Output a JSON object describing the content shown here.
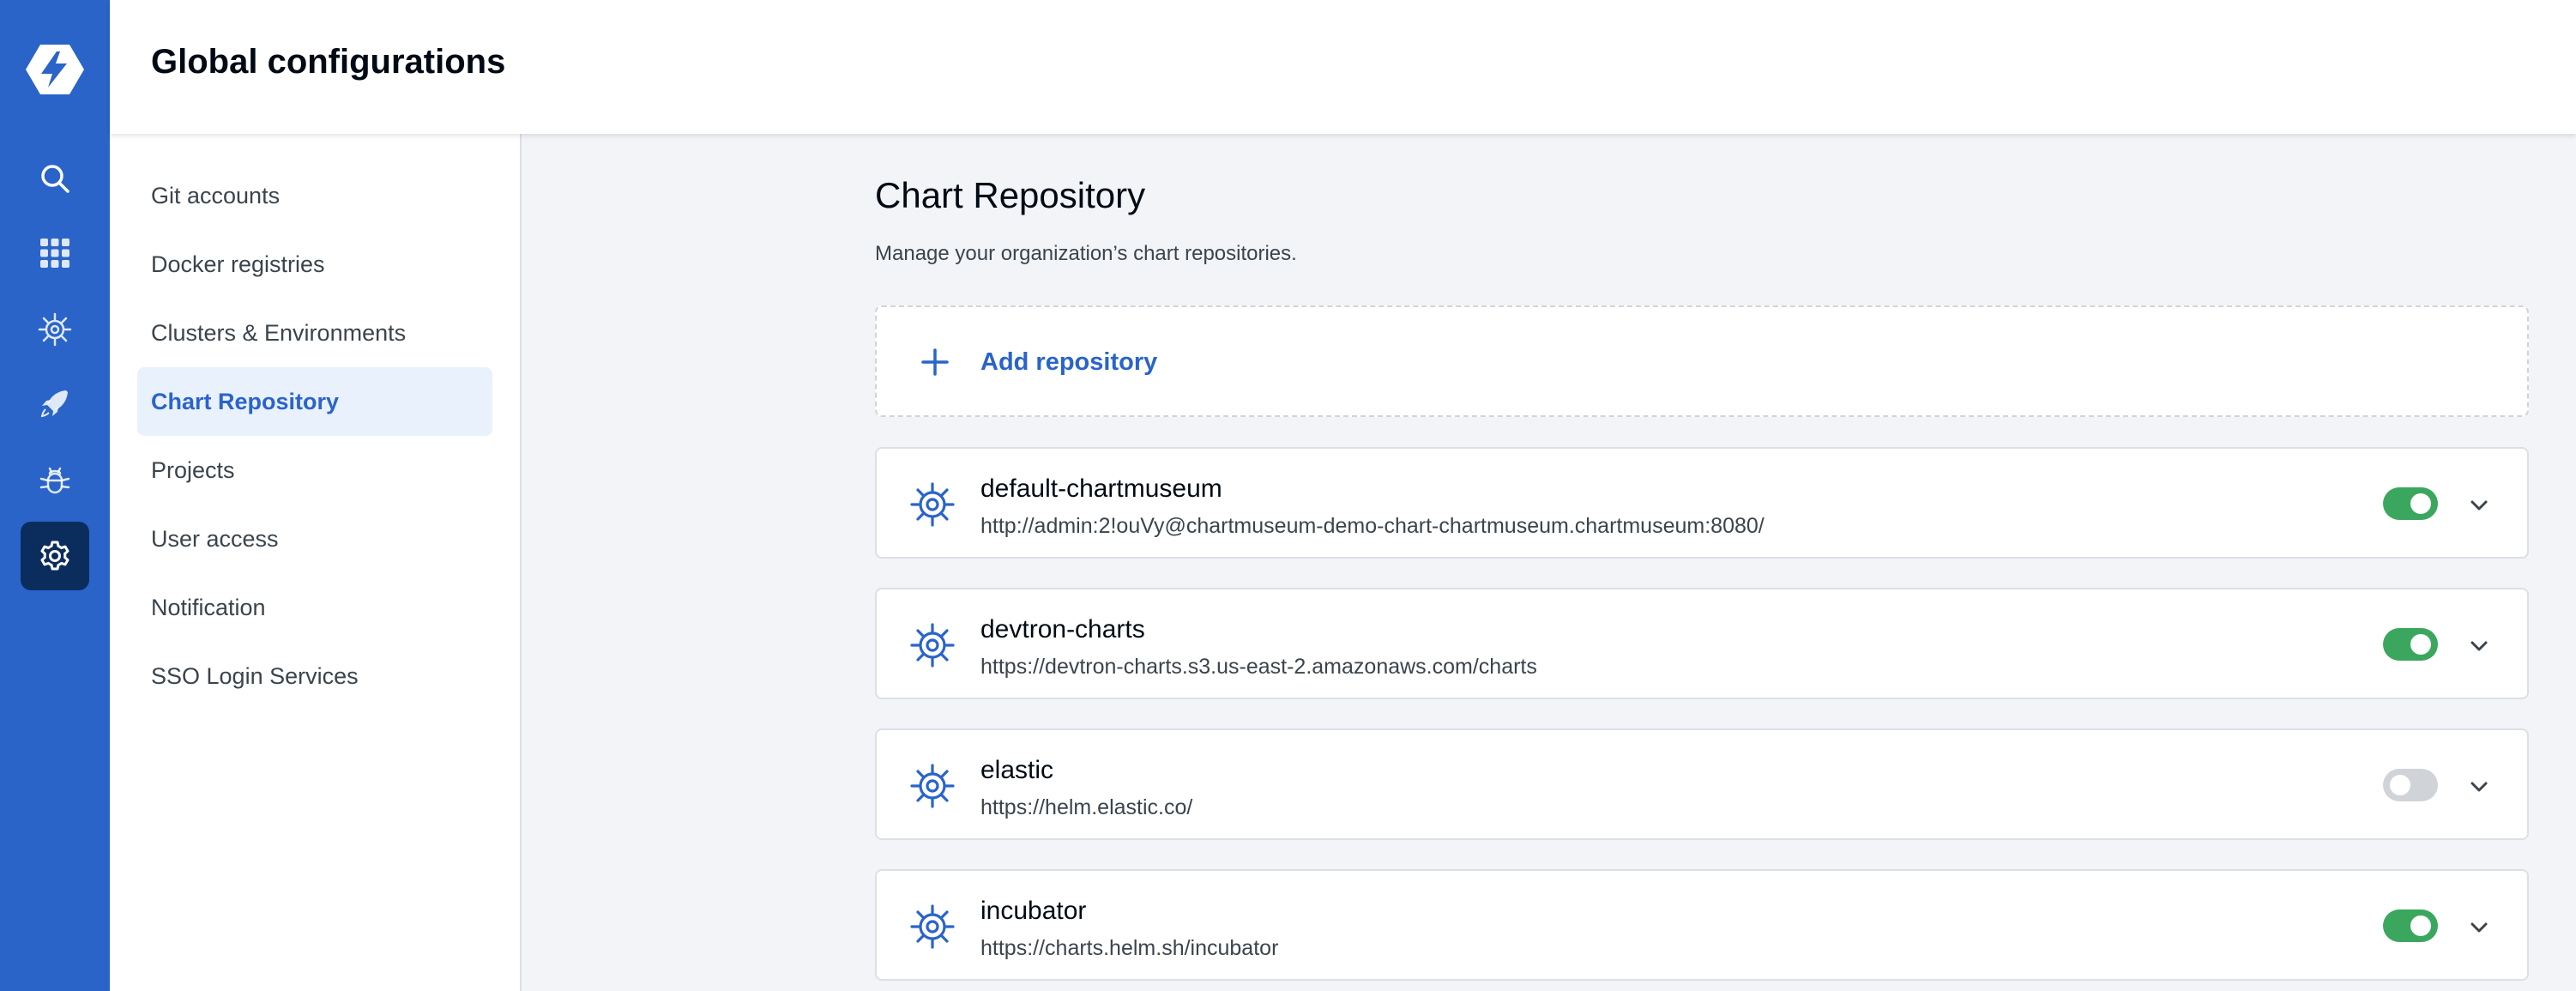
{
  "app": {
    "brand": "Devtron",
    "accent_color": "#2a64c9",
    "rail_active_color": "#0b2d5e",
    "toggle_on_color": "#3ba75e",
    "toggle_off_color": "#d0d4d9"
  },
  "rail": {
    "items": [
      {
        "icon": "search-icon",
        "active": false
      },
      {
        "icon": "apps-grid-icon",
        "active": false
      },
      {
        "icon": "helm-chart-icon",
        "active": false
      },
      {
        "icon": "rocket-icon",
        "active": false
      },
      {
        "icon": "bug-icon",
        "active": false
      },
      {
        "icon": "gear-icon",
        "active": true
      }
    ]
  },
  "header": {
    "title": "Global configurations"
  },
  "subnav": {
    "items": [
      {
        "label": "Git accounts",
        "active": false
      },
      {
        "label": "Docker registries",
        "active": false
      },
      {
        "label": "Clusters & Environments",
        "active": false
      },
      {
        "label": "Chart Repository",
        "active": true
      },
      {
        "label": "Projects",
        "active": false
      },
      {
        "label": "User access",
        "active": false
      },
      {
        "label": "Notification",
        "active": false
      },
      {
        "label": "SSO Login Services",
        "active": false
      }
    ]
  },
  "main": {
    "title": "Chart Repository",
    "description": "Manage your organization’s chart repositories.",
    "add_label": "Add repository",
    "repositories": [
      {
        "name": "default-chartmuseum",
        "url": "http://admin:2!ouVy@chartmuseum-demo-chart-chartmuseum.chartmuseum:8080/",
        "enabled": true
      },
      {
        "name": "devtron-charts",
        "url": "https://devtron-charts.s3.us-east-2.amazonaws.com/charts",
        "enabled": true
      },
      {
        "name": "elastic",
        "url": "https://helm.elastic.co/",
        "enabled": false
      },
      {
        "name": "incubator",
        "url": "https://charts.helm.sh/incubator",
        "enabled": true
      }
    ]
  }
}
